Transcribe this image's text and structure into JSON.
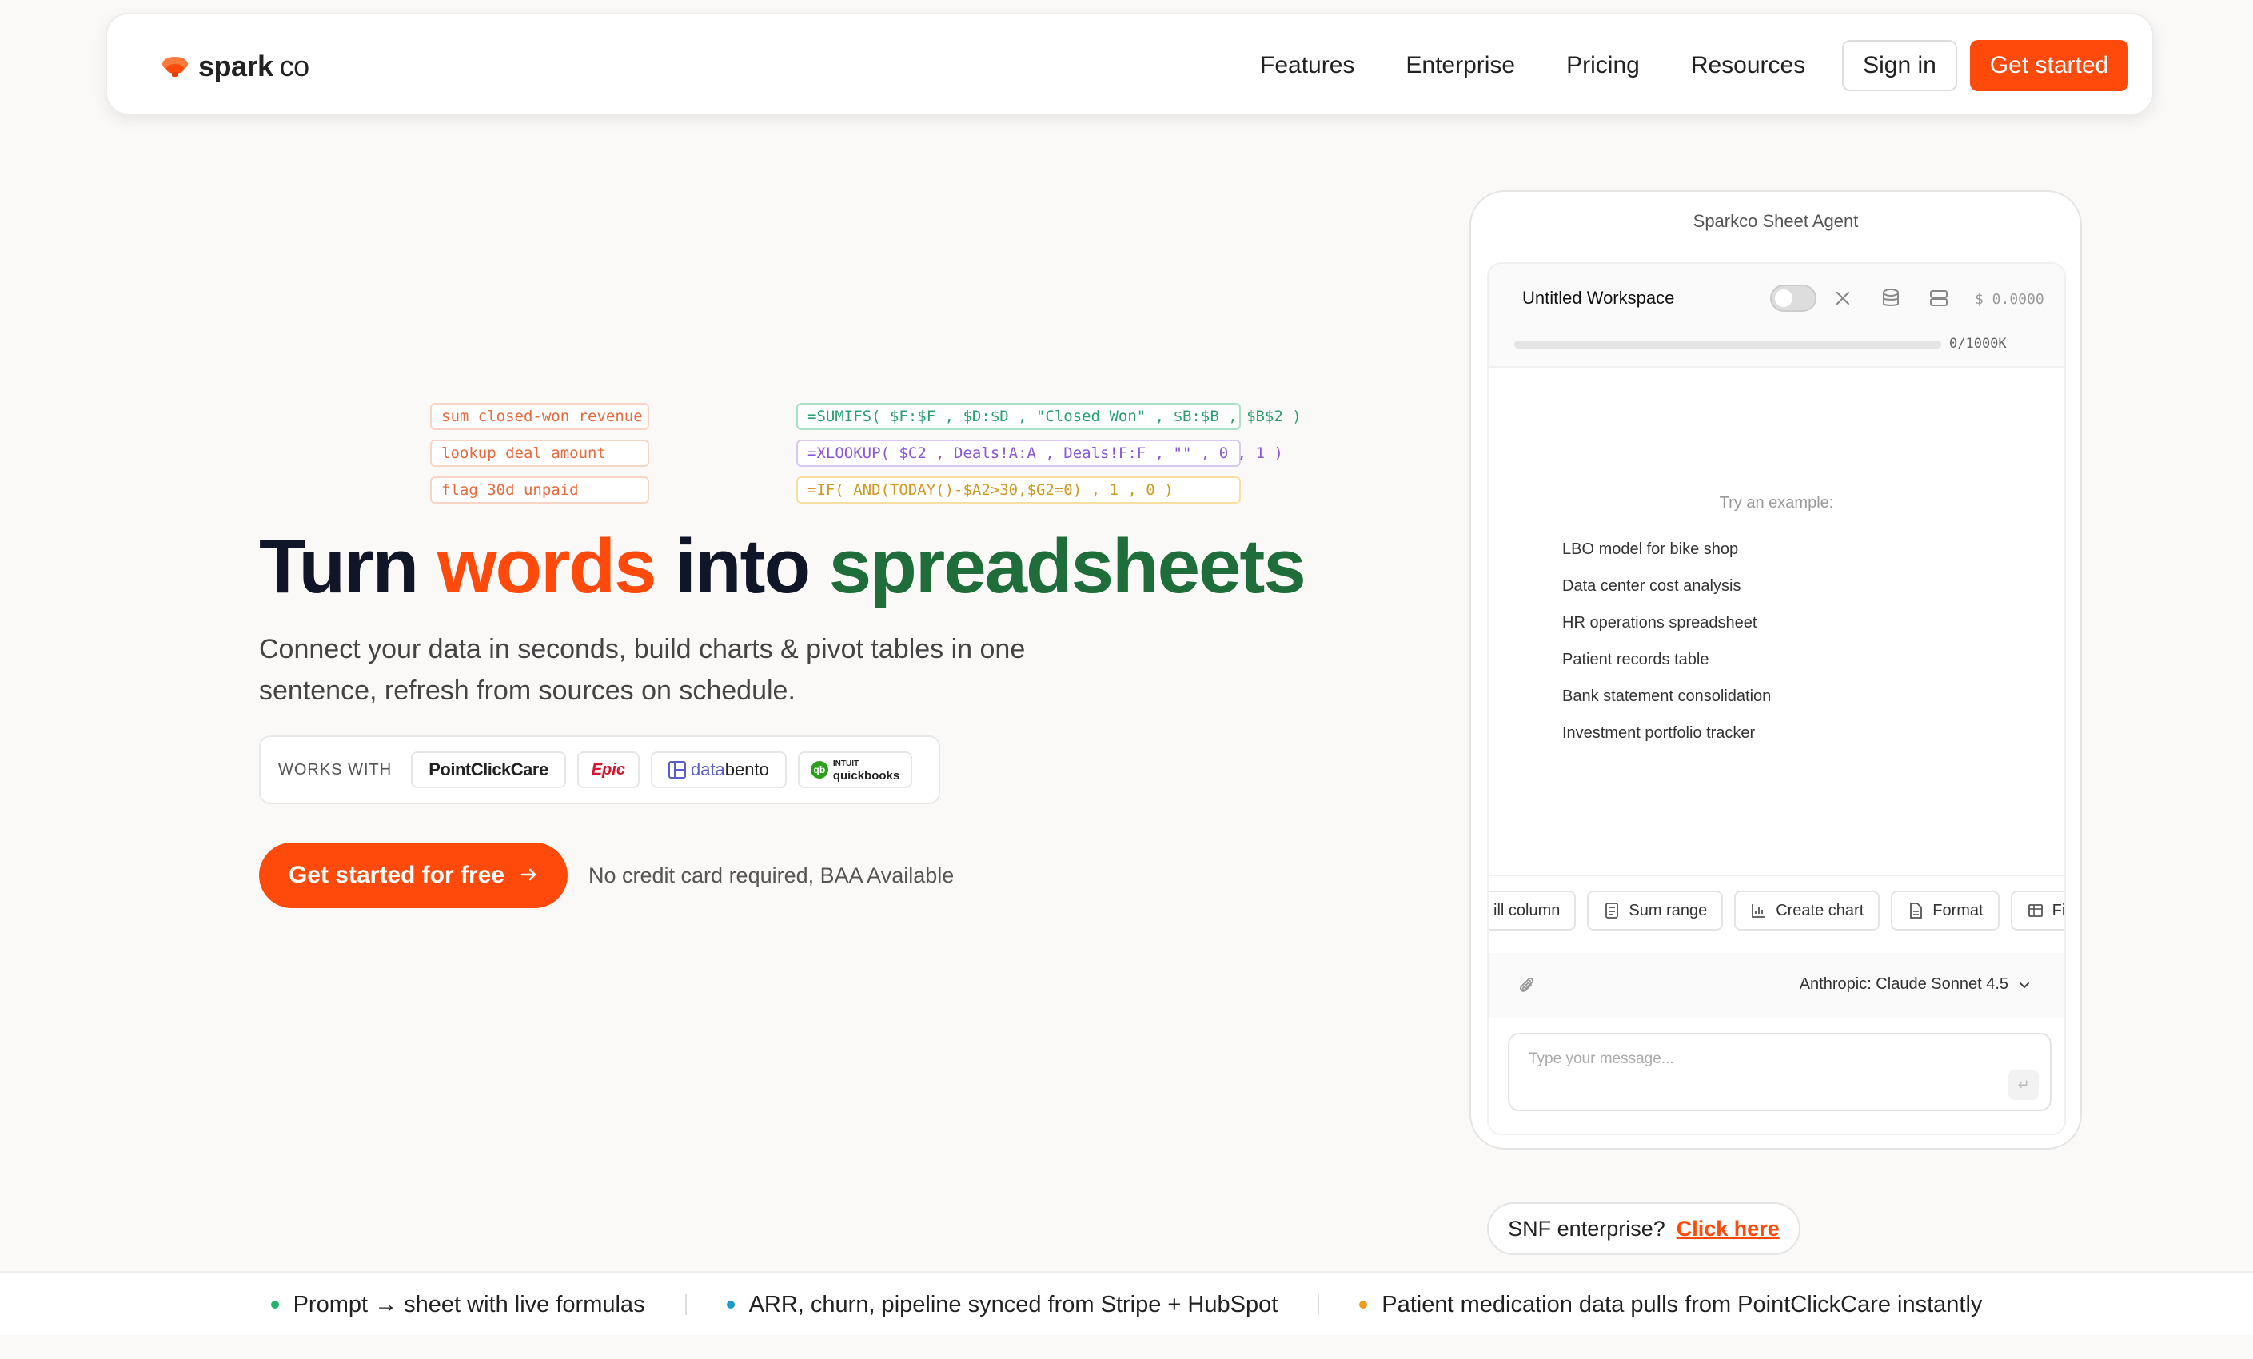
{
  "nav": {
    "logo_main": "spark",
    "logo_suffix": "co",
    "links": [
      "Features",
      "Enterprise",
      "Pricing",
      "Resources"
    ],
    "sign_in": "Sign in",
    "get_started": "Get started",
    "accent": "#ff4a0b"
  },
  "formulas": {
    "prompts": [
      "sum closed-won revenue",
      "lookup deal amount",
      "flag 30d unpaid"
    ],
    "outputs": [
      "=SUMIFS( $F:$F , $D:$D , \"Closed Won\" , $B:$B , $B$2 )",
      "=XLOOKUP( $C2 , Deals!A:A , Deals!F:F , \"\" , 0 , 1 )",
      "=IF( AND(TODAY()-$A2>30,$G2=0) , 1 , 0 )"
    ]
  },
  "hero": {
    "title_1": "Turn",
    "title_2": "words",
    "title_3": "into",
    "title_4": "spreadsheets",
    "subtitle": "Connect your data in seconds, build charts & pivot tables in one sentence, refresh from sources on schedule.",
    "works_with": "WORKS WITH",
    "partners": {
      "pcc": "PointClickCare",
      "epic": "Epic",
      "databento_a": "data",
      "databento_b": "bento",
      "qb_top": "INTUIT",
      "qb_bottom": "quickbooks"
    },
    "cta": "Get started for free",
    "cta_note": "No credit card required, BAA Available"
  },
  "agent": {
    "title": "Sparkco Sheet Agent",
    "workspace": "Untitled Workspace",
    "cost": "$ 0.0000",
    "usage_label": "0/1000K",
    "usage_fraction": 0,
    "try_label": "Try an example:",
    "examples": [
      "LBO model for bike shop",
      "Data center cost analysis",
      "HR operations spreadsheet",
      "Patient records table",
      "Bank statement consolidation",
      "Investment portfolio tracker"
    ],
    "actions": [
      "ill column",
      "Sum range",
      "Create chart",
      "Format",
      "Fill"
    ],
    "model": "Anthropic: Claude Sonnet 4.5",
    "message_placeholder": "Type your message..."
  },
  "snf": {
    "label": "SNF enterprise?",
    "link": "Click here"
  },
  "strip": [
    {
      "text": "Prompt → sheet with live formulas",
      "color": "#1fb36b"
    },
    {
      "text": "ARR, churn, pipeline synced from Stripe + HubSpot",
      "color": "#1a9ad6"
    },
    {
      "text": "Patient medication data pulls from PointClickCare instantly",
      "color": "#f39a1b"
    }
  ]
}
